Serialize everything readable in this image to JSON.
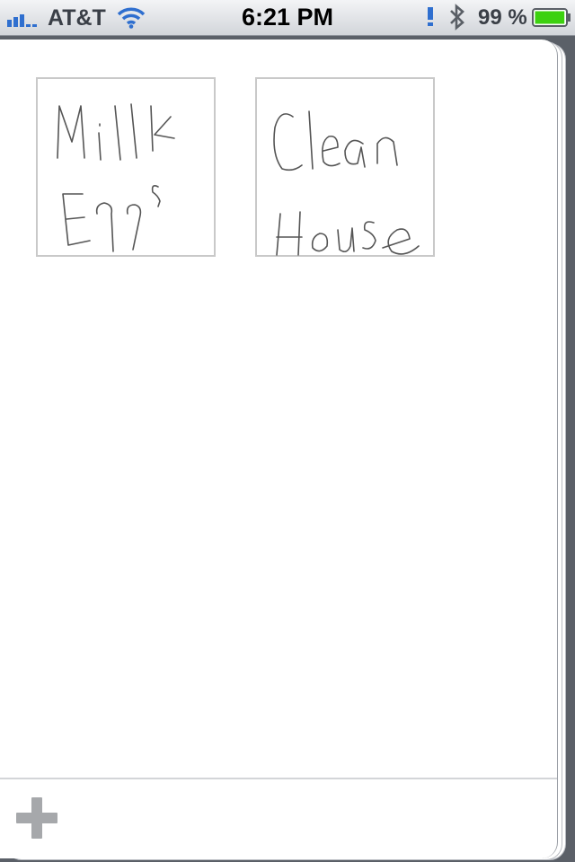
{
  "status_bar": {
    "carrier": "AT&T",
    "time": "6:21 PM",
    "battery_percent": "99 %",
    "signal_icon": "signal-bars-icon",
    "wifi_icon": "wifi-icon",
    "bluetooth_icon": "bluetooth-icon",
    "battery_icon": "battery-icon",
    "battery_level": 0.99,
    "battery_color": "#3cd10f"
  },
  "notes": [
    {
      "handwritten_text": "Milk Eggs"
    },
    {
      "handwritten_text": "Clean House"
    }
  ],
  "toolbar": {
    "add_icon": "plus-icon"
  },
  "colors": {
    "background": "#5b6068",
    "sheet": "#ffffff",
    "card_border": "#c9c9c9",
    "ink": "#555555",
    "plus": "#a6a8ab"
  }
}
